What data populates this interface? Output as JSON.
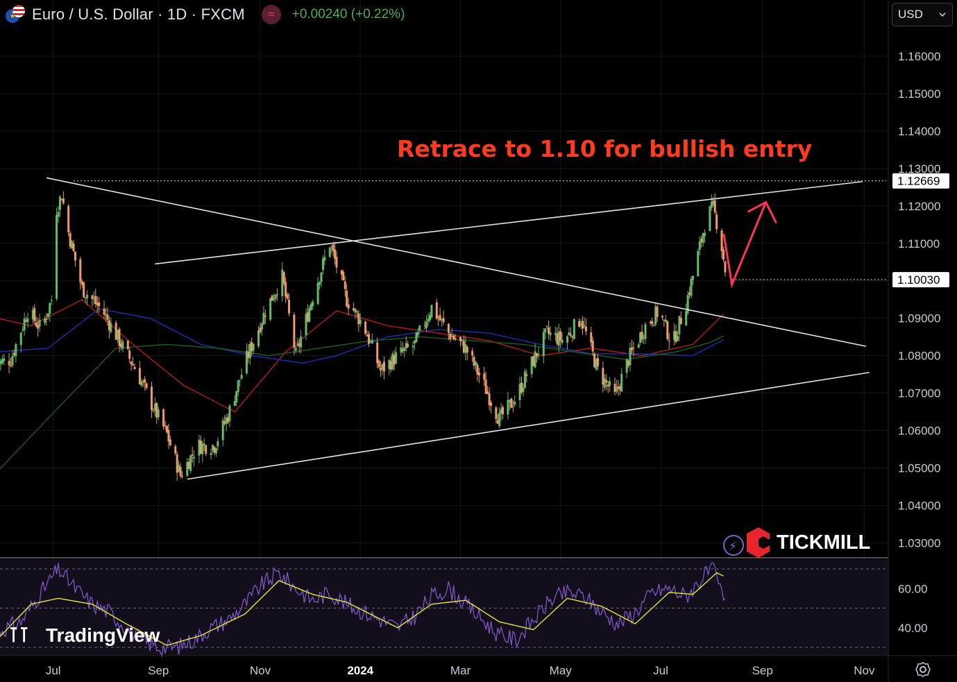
{
  "header": {
    "pair": "Euro / U.S. Dollar · 1D · FXCM",
    "indicator_badge": "≈",
    "change": "+0.00240 (+0.22%)"
  },
  "currency_select": {
    "value": "USD",
    "icon": "chevron-down-icon"
  },
  "annotation": "Retrace to 1.10 for bullish entry",
  "watermark": "TradingView",
  "broker_logo": "TICKMILL",
  "colors": {
    "up": "#66bb6a",
    "down": "#ef9a6a",
    "ma_red": "#b71c1c",
    "ma_blue": "#1e2fb0",
    "ma_green": "#1b5e20",
    "rsi": "#7e57c2",
    "rsi_ma": "#e6e63a",
    "annotation": "#ff3b1f",
    "arrow": "#ff3355"
  },
  "chart_data": [
    {
      "type": "candlestick",
      "title": "Euro / U.S. Dollar · 1D · FXCM",
      "x_ticks": [
        "Jul",
        "Sep",
        "Nov",
        "2024",
        "Mar",
        "May",
        "Jul",
        "Sep",
        "Nov"
      ],
      "y_ticks": [
        "1.16000",
        "1.15000",
        "1.14000",
        "1.13000",
        "1.12000",
        "1.11000",
        "1.10000",
        "1.09000",
        "1.08000",
        "1.07000",
        "1.06000",
        "1.05000",
        "1.04000",
        "1.03000"
      ],
      "ylim": [
        1.0245,
        1.1655
      ],
      "price_labels": [
        "1.12669",
        "1.10030"
      ],
      "levels": [
        1.12669,
        1.1003
      ],
      "close_waypoints": [
        [
          0,
          1.078
        ],
        [
          8,
          1.079
        ],
        [
          18,
          1.092
        ],
        [
          26,
          1.087
        ],
        [
          32,
          1.095
        ],
        [
          34,
          1.118
        ],
        [
          38,
          1.123
        ],
        [
          42,
          1.113
        ],
        [
          50,
          1.098
        ],
        [
          62,
          1.092
        ],
        [
          72,
          1.084
        ],
        [
          82,
          1.076
        ],
        [
          90,
          1.068
        ],
        [
          100,
          1.059
        ],
        [
          108,
          1.048
        ],
        [
          118,
          1.056
        ],
        [
          128,
          1.056
        ],
        [
          136,
          1.064
        ],
        [
          146,
          1.078
        ],
        [
          158,
          1.092
        ],
        [
          168,
          1.101
        ],
        [
          176,
          1.08
        ],
        [
          186,
          1.096
        ],
        [
          196,
          1.11
        ],
        [
          206,
          1.095
        ],
        [
          216,
          1.088
        ],
        [
          226,
          1.076
        ],
        [
          236,
          1.08
        ],
        [
          246,
          1.083
        ],
        [
          256,
          1.093
        ],
        [
          266,
          1.086
        ],
        [
          276,
          1.082
        ],
        [
          286,
          1.073
        ],
        [
          296,
          1.063
        ],
        [
          306,
          1.069
        ],
        [
          314,
          1.077
        ],
        [
          324,
          1.086
        ],
        [
          334,
          1.084
        ],
        [
          344,
          1.09
        ],
        [
          354,
          1.076
        ],
        [
          364,
          1.069
        ],
        [
          372,
          1.079
        ],
        [
          382,
          1.088
        ],
        [
          390,
          1.092
        ],
        [
          398,
          1.083
        ],
        [
          406,
          1.094
        ],
        [
          412,
          1.105
        ],
        [
          418,
          1.117
        ],
        [
          422,
          1.1195
        ],
        [
          426,
          1.112
        ],
        [
          429,
          1.103
        ]
      ],
      "moving_averages": [
        {
          "name": "MA red",
          "color": "#b71c1c",
          "points": [
            [
              0,
              1.09
            ],
            [
              20,
              1.088
            ],
            [
              50,
              1.095
            ],
            [
              80,
              1.083
            ],
            [
              110,
              1.072
            ],
            [
              140,
              1.065
            ],
            [
              170,
              1.081
            ],
            [
              200,
              1.092
            ],
            [
              230,
              1.088
            ],
            [
              260,
              1.086
            ],
            [
              290,
              1.084
            ],
            [
              320,
              1.08
            ],
            [
              350,
              1.082
            ],
            [
              380,
              1.08
            ],
            [
              410,
              1.083
            ],
            [
              429,
              1.0915
            ]
          ]
        },
        {
          "name": "MA blue",
          "color": "#1e2fb0",
          "points": [
            [
              0,
              1.081
            ],
            [
              30,
              1.082
            ],
            [
              60,
              1.0925
            ],
            [
              90,
              1.09
            ],
            [
              120,
              1.083
            ],
            [
              150,
              1.08
            ],
            [
              180,
              1.078
            ],
            [
              200,
              1.08
            ],
            [
              230,
              1.085
            ],
            [
              260,
              1.087
            ],
            [
              290,
              1.086
            ],
            [
              320,
              1.083
            ],
            [
              350,
              1.0805
            ],
            [
              380,
              1.0805
            ],
            [
              410,
              1.08
            ],
            [
              429,
              1.0845
            ]
          ]
        },
        {
          "name": "MA green",
          "color": "#1b5e20",
          "points": [
            [
              0,
              1.049
            ],
            [
              40,
              1.068
            ],
            [
              70,
              1.082
            ],
            [
              100,
              1.083
            ],
            [
              130,
              1.082
            ],
            [
              160,
              1.08
            ],
            [
              190,
              1.082
            ],
            [
              220,
              1.084
            ],
            [
              250,
              1.085
            ],
            [
              280,
              1.084
            ],
            [
              310,
              1.083
            ],
            [
              340,
              1.081
            ],
            [
              370,
              1.079
            ],
            [
              400,
              1.081
            ],
            [
              420,
              1.0835
            ],
            [
              429,
              1.0855
            ]
          ]
        }
      ],
      "trendlines": [
        {
          "name": "descending resistance",
          "from": [
            29,
            1.1275
          ],
          "to": [
            512,
            1.0825
          ]
        },
        {
          "name": "ascending support",
          "from": [
            112,
            1.047
          ],
          "to": [
            514,
            1.0755
          ]
        },
        {
          "name": "upper channel",
          "from": [
            93,
            1.1045
          ],
          "to": [
            510,
            1.1265
          ]
        },
        {
          "name": "1.12669 level",
          "from": [
            45,
            1.12669
          ],
          "to": [
            524,
            1.12669
          ]
        },
        {
          "name": "1.10030 level",
          "from": [
            433,
            1.1003
          ],
          "to": [
            524,
            1.1003
          ]
        }
      ],
      "projection_arrow": [
        [
          433,
          1.099
        ],
        [
          453,
          1.121
        ]
      ]
    },
    {
      "type": "line",
      "title": "RSI",
      "y_ticks": [
        "60.00",
        "40.00"
      ],
      "ylim": [
        25,
        73
      ],
      "reference_levels": [
        70,
        50,
        30
      ],
      "rsi_waypoints": [
        [
          0,
          38
        ],
        [
          14,
          43
        ],
        [
          26,
          58
        ],
        [
          36,
          70
        ],
        [
          46,
          60
        ],
        [
          56,
          52
        ],
        [
          66,
          48
        ],
        [
          76,
          40
        ],
        [
          86,
          33
        ],
        [
          96,
          30
        ],
        [
          106,
          30
        ],
        [
          116,
          34
        ],
        [
          126,
          40
        ],
        [
          136,
          44
        ],
        [
          146,
          52
        ],
        [
          156,
          62
        ],
        [
          166,
          68
        ],
        [
          176,
          60
        ],
        [
          186,
          54
        ],
        [
          196,
          58
        ],
        [
          206,
          52
        ],
        [
          216,
          48
        ],
        [
          226,
          44
        ],
        [
          236,
          40
        ],
        [
          246,
          46
        ],
        [
          256,
          56
        ],
        [
          266,
          60
        ],
        [
          276,
          52
        ],
        [
          286,
          44
        ],
        [
          296,
          36
        ],
        [
          306,
          34
        ],
        [
          316,
          44
        ],
        [
          326,
          54
        ],
        [
          336,
          58
        ],
        [
          346,
          56
        ],
        [
          356,
          48
        ],
        [
          366,
          42
        ],
        [
          376,
          48
        ],
        [
          386,
          58
        ],
        [
          396,
          60
        ],
        [
          406,
          56
        ],
        [
          416,
          66
        ],
        [
          422,
          70
        ],
        [
          429,
          52
        ]
      ],
      "ma_waypoints": [
        [
          0,
          34
        ],
        [
          20,
          52
        ],
        [
          36,
          55
        ],
        [
          56,
          52
        ],
        [
          76,
          42
        ],
        [
          100,
          31
        ],
        [
          120,
          36
        ],
        [
          146,
          47
        ],
        [
          166,
          64
        ],
        [
          186,
          57
        ],
        [
          206,
          53
        ],
        [
          236,
          40
        ],
        [
          256,
          52
        ],
        [
          276,
          54
        ],
        [
          296,
          43
        ],
        [
          316,
          39
        ],
        [
          336,
          55
        ],
        [
          356,
          51
        ],
        [
          376,
          42
        ],
        [
          396,
          58
        ],
        [
          410,
          57
        ],
        [
          424,
          68
        ],
        [
          429,
          66
        ]
      ]
    }
  ]
}
